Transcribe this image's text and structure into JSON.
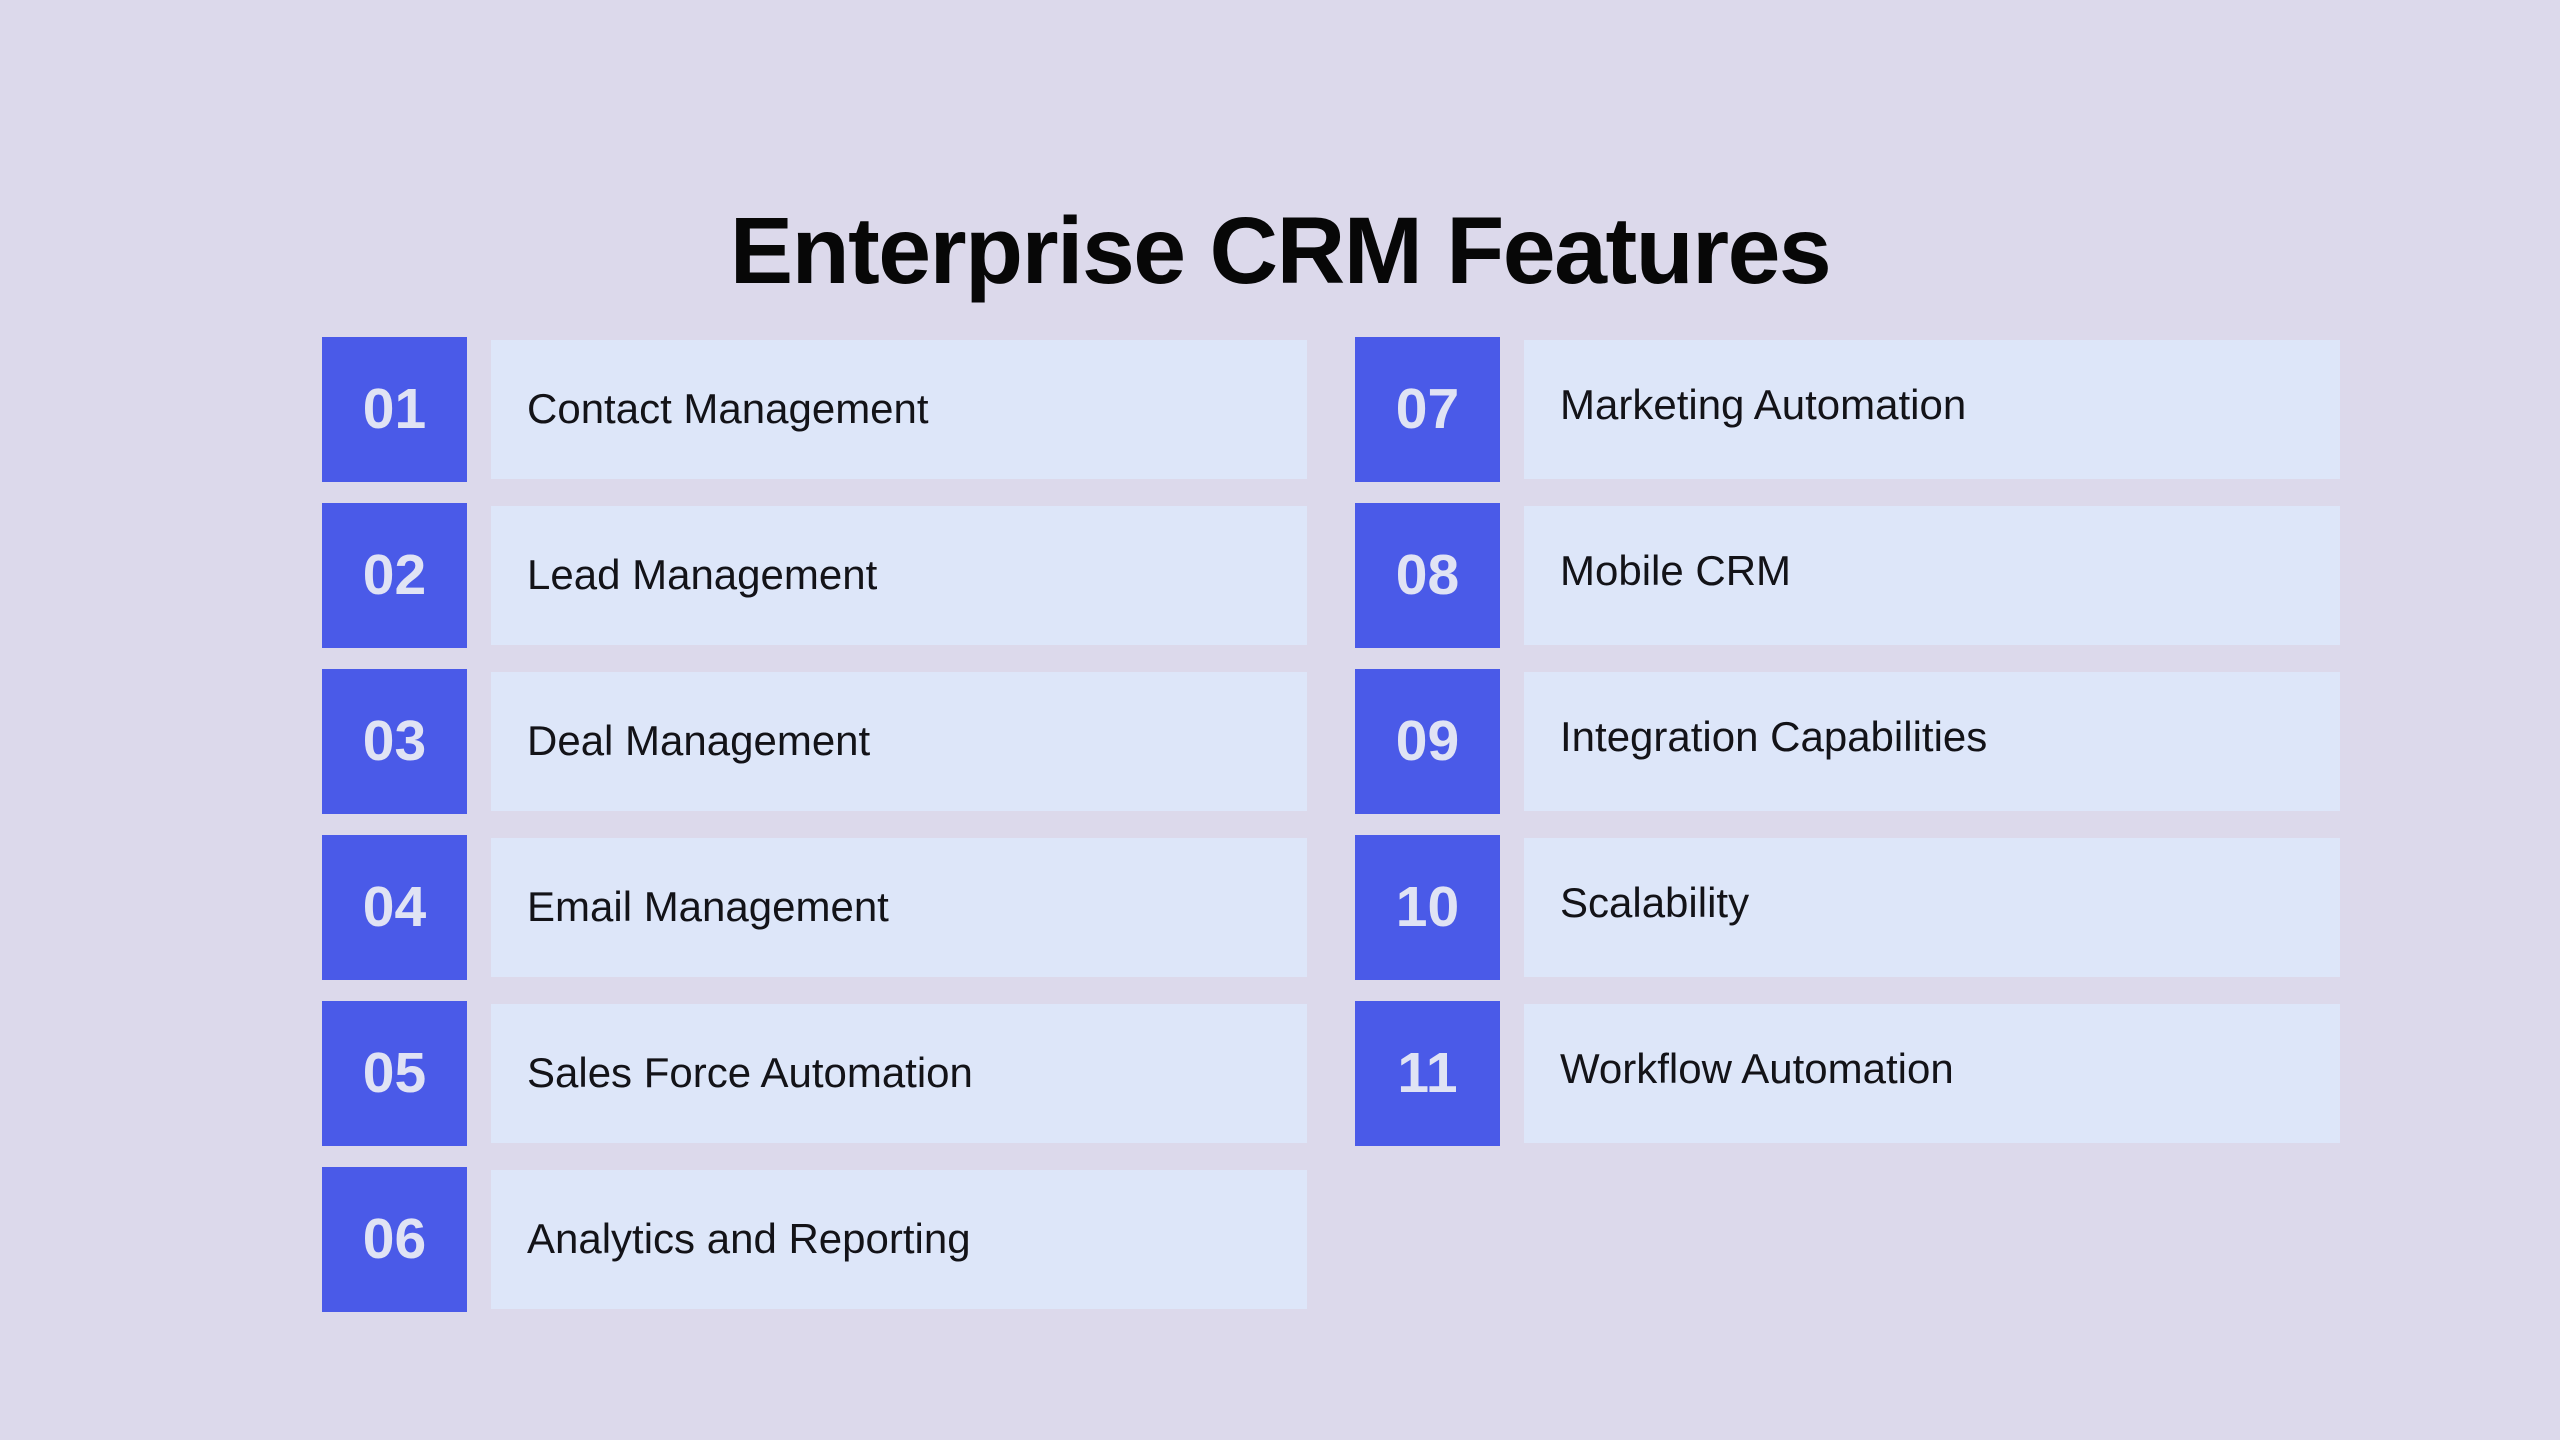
{
  "page": {
    "title": "Enterprise CRM Features",
    "background_color": "#dcd9eb",
    "accent_color": "#4a5ae8",
    "panel_color": "#dde6f9",
    "number_text_color": "#e0e3f4",
    "label_text_color": "#131318",
    "title_color": "#070707"
  },
  "columns": {
    "left": {
      "items": [
        {
          "number": "01",
          "label": "Contact Management"
        },
        {
          "number": "02",
          "label": "Lead Management"
        },
        {
          "number": "03",
          "label": "Deal Management"
        },
        {
          "number": "04",
          "label": "Email Management"
        },
        {
          "number": "05",
          "label": "Sales Force Automation"
        },
        {
          "number": "06",
          "label": "Analytics and Reporting"
        }
      ]
    },
    "right": {
      "items": [
        {
          "number": "07",
          "label": "Marketing Automation"
        },
        {
          "number": "08",
          "label": "Mobile CRM"
        },
        {
          "number": "09",
          "label": "Integration Capabilities"
        },
        {
          "number": "10",
          "label": "Scalability"
        },
        {
          "number": "11",
          "label": "Workflow Automation"
        }
      ]
    }
  }
}
